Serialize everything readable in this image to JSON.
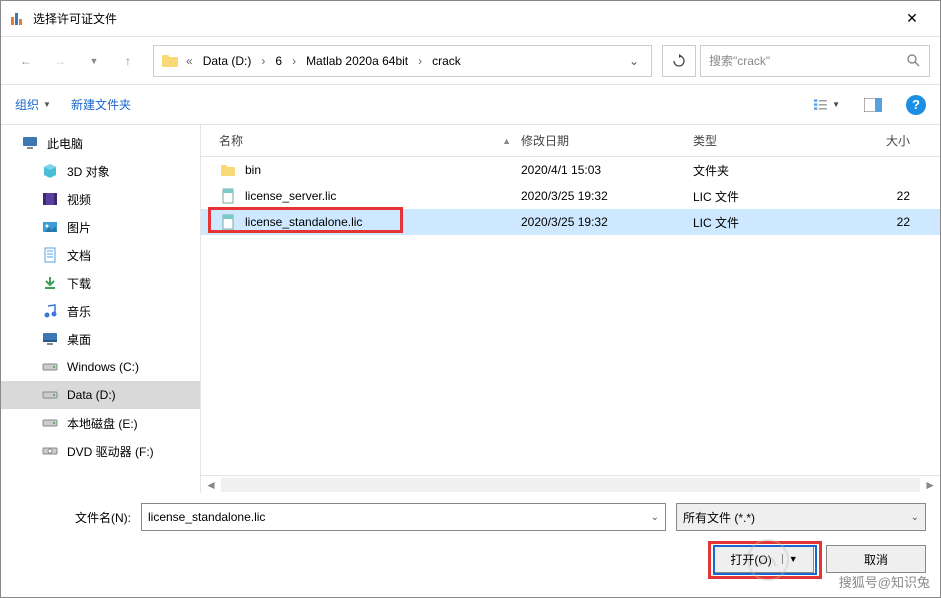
{
  "title": "选择许可证文件",
  "breadcrumb": {
    "items": [
      "Data (D:)",
      "6",
      "Matlab 2020a 64bit",
      "crack"
    ]
  },
  "search": {
    "placeholder": "搜索\"crack\""
  },
  "toolbar": {
    "organize": "组织",
    "newfolder": "新建文件夹"
  },
  "columns": {
    "name": "名称",
    "date": "修改日期",
    "type": "类型",
    "size": "大小"
  },
  "sidebar": [
    {
      "label": "此电脑",
      "icon": "pc",
      "indent": false
    },
    {
      "label": "3D 对象",
      "icon": "3d",
      "indent": true
    },
    {
      "label": "视频",
      "icon": "video",
      "indent": true
    },
    {
      "label": "图片",
      "icon": "image",
      "indent": true
    },
    {
      "label": "文档",
      "icon": "doc",
      "indent": true
    },
    {
      "label": "下载",
      "icon": "download",
      "indent": true
    },
    {
      "label": "音乐",
      "icon": "music",
      "indent": true
    },
    {
      "label": "桌面",
      "icon": "desktop",
      "indent": true
    },
    {
      "label": "Windows (C:)",
      "icon": "disk",
      "indent": true
    },
    {
      "label": "Data (D:)",
      "icon": "disk",
      "indent": true,
      "selected": true
    },
    {
      "label": "本地磁盘 (E:)",
      "icon": "disk",
      "indent": true
    },
    {
      "label": "DVD 驱动器 (F:)",
      "icon": "dvd",
      "indent": true
    }
  ],
  "files": [
    {
      "name": "bin",
      "date": "2020/4/1 15:03",
      "type": "文件夹",
      "size": "",
      "icon": "folder",
      "selected": false
    },
    {
      "name": "license_server.lic",
      "date": "2020/3/25 19:32",
      "type": "LIC 文件",
      "size": "22",
      "icon": "lic",
      "selected": false
    },
    {
      "name": "license_standalone.lic",
      "date": "2020/3/25 19:32",
      "type": "LIC 文件",
      "size": "22",
      "icon": "lic",
      "selected": true
    }
  ],
  "footer": {
    "filename_label": "文件名(N):",
    "filename_value": "license_standalone.lic",
    "filetype": "所有文件 (*.*)",
    "open": "打开(O)",
    "cancel": "取消"
  },
  "watermark": "搜狐号@知识兔"
}
